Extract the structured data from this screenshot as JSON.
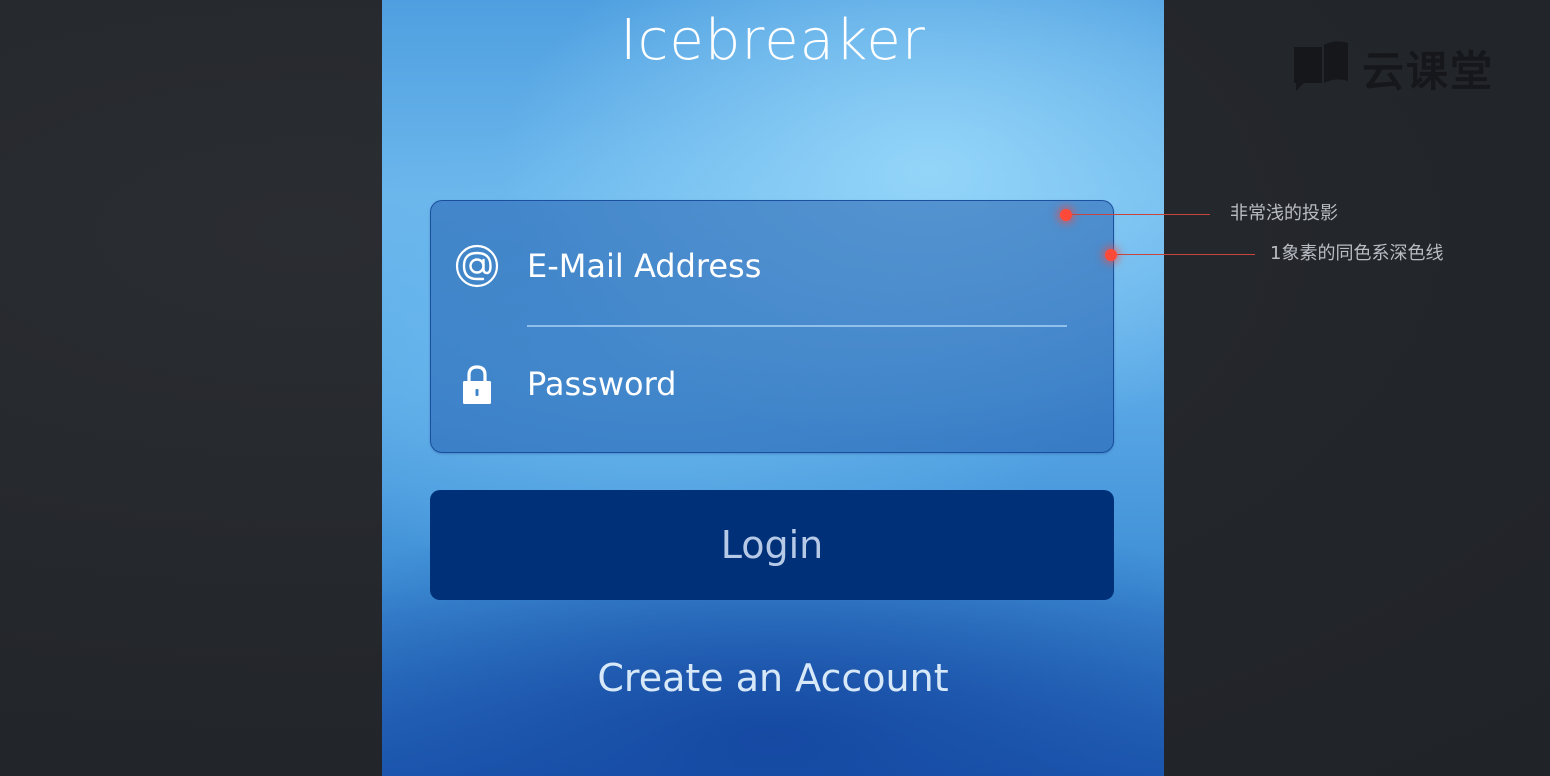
{
  "app": {
    "title": "Icebreaker"
  },
  "login_form": {
    "email_placeholder": "E-Mail Address",
    "email_icon": "at-sign-icon",
    "password_placeholder": "Password",
    "password_icon": "lock-icon",
    "login_label": "Login",
    "create_account_label": "Create an Account"
  },
  "annotations": [
    {
      "text": "非常浅的投影"
    },
    {
      "text": "1象素的同色系深色线"
    }
  ],
  "watermark": {
    "text": "云课堂",
    "icon": "book-logo-icon"
  },
  "colors": {
    "background": "#25282d",
    "login_button": "#003178",
    "login_text": "#b6c9e6",
    "annotation_dot": "#ff4a3a",
    "annotation_text": "#b9bcc2"
  }
}
